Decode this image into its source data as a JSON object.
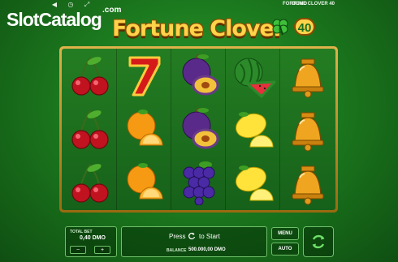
{
  "site_logo": {
    "part1": "Slot",
    "part2": "Catalog",
    "suffix": ".com"
  },
  "topbar": {
    "mode": "DEMO",
    "game_title": "FORTUNE CLOVER 40",
    "icons": [
      "speaker-icon",
      "clock-icon",
      "fullscreen-icon"
    ]
  },
  "game_logo": {
    "text": "Fortune Clover",
    "badge": "40"
  },
  "reels": [
    [
      "cherry",
      "cherry",
      "cherry"
    ],
    [
      "seven",
      "orange",
      "orange"
    ],
    [
      "plum",
      "plum",
      "grapes"
    ],
    [
      "watermelon",
      "lemon",
      "lemon"
    ],
    [
      "bell",
      "bell",
      "bell"
    ]
  ],
  "footer": {
    "total_bet_label": "TOTAL BET",
    "total_bet_value": "0,40 DMO",
    "minus": "−",
    "plus": "+",
    "press": "Press",
    "to_start": "to Start",
    "balance_label": "BALANCE",
    "balance_value": "500.000,00 DMO",
    "menu": "MENU",
    "auto": "AUTO"
  },
  "colors": {
    "accent_gold": "#ffd34a",
    "felt_green": "#1c7a1e",
    "panel_border": "#6fc06a"
  }
}
